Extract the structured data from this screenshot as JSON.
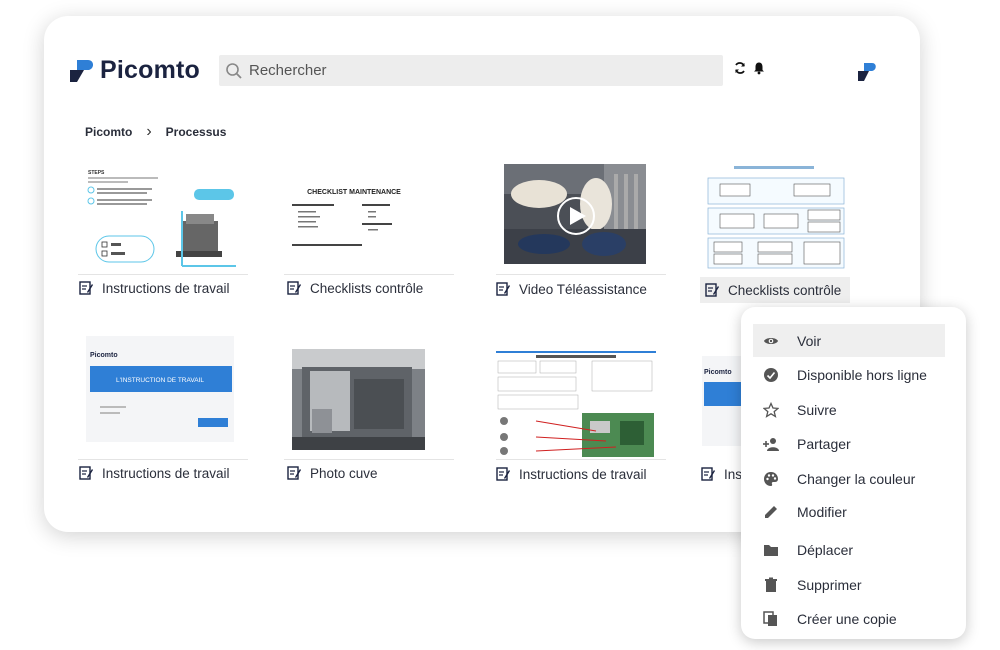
{
  "app": {
    "name": "Picomto"
  },
  "search": {
    "placeholder": "Rechercher"
  },
  "breadcrumb": {
    "root": "Picomto",
    "current": "Processus"
  },
  "cards": [
    {
      "label": "Instructions de travail"
    },
    {
      "label": "Checklists contrôle"
    },
    {
      "label": "Video Téléassistance"
    },
    {
      "label": "Checklists contrôle"
    },
    {
      "label": "Instructions de travail"
    },
    {
      "label": "Photo cuve"
    },
    {
      "label": "Instructions de travail"
    },
    {
      "label": "Ins"
    }
  ],
  "thumbs": {
    "steps_title": "STEPS",
    "checklist_title": "CHECKLIST MAINTENANCE",
    "instruction_banner": "L'INSTRUCTION DE TRAVAIL",
    "picomto_small": "Picomto"
  },
  "context_menu": {
    "items": [
      {
        "label": "Voir",
        "icon": "eye-icon"
      },
      {
        "label": "Disponible hors ligne",
        "icon": "offline-check-icon"
      },
      {
        "label": "Suivre",
        "icon": "star-icon"
      },
      {
        "label": "Partager",
        "icon": "add-person-icon"
      },
      {
        "label": "Changer la couleur",
        "icon": "palette-icon"
      },
      {
        "label": "Modifier",
        "icon": "pencil-icon"
      },
      {
        "label": "Déplacer",
        "icon": "folder-icon"
      },
      {
        "label": "Supprimer",
        "icon": "trash-icon"
      },
      {
        "label": "Créer une copie",
        "icon": "copy-icon"
      }
    ]
  },
  "colors": {
    "brand_navy": "#1b2340",
    "brand_blue": "#2f7fd6",
    "accent_cyan": "#5cc6e8"
  }
}
